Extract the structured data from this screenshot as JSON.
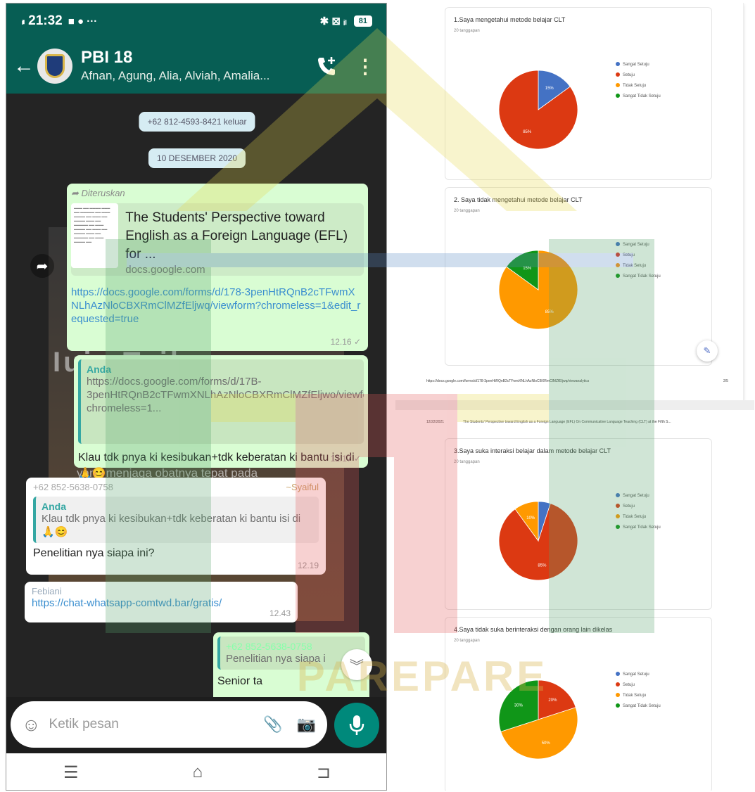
{
  "status_bar": {
    "signal": "ᵢₗₗ",
    "time": "21:32",
    "icons": "■ ● ···",
    "right_icons": "✱ ⊠ ᵢₗ",
    "battery": "81"
  },
  "header": {
    "back_icon": "←",
    "group_name": "PBI 18",
    "members": "Afnan, Agung, Alia, Alviah, Amalia...",
    "menu_icon": "⋮"
  },
  "system_messages": {
    "left_notice": "+62 812-4593-8421 keluar",
    "date": "10 DESEMBER 2020"
  },
  "messages": {
    "forwarded": {
      "forwarded_label": "Diteruskan",
      "preview_title": "The Students' Perspective toward English as a Foreign Language (EFL) for ...",
      "preview_domain": "docs.google.com",
      "link": "https://docs.google.com/forms/d/178-3penHtRQnB2cTFwmXNLhAzNloCBXRmClMZfEljwq/viewform?chromeless=1&edit_requested=true",
      "time": "12.16 ✓"
    },
    "reply_own": {
      "quote_name": "Anda",
      "quote_text": "https://docs.google.com/forms/d/17B-3penHtRQnB2cTFwmXNLhAzNloCBXRmClMZfEljwo/viewform?chromeless=1...",
      "text": "Klau tdk pnya ki kesibukan+tdk keberatan ki bantu isi di🙏😊",
      "time": "12.17 ✓"
    },
    "reply_in": {
      "sender_number": "+62 852-5638-0758",
      "sender_name": "~Syaiful",
      "quote_name": "Anda",
      "quote_text": "Klau tdk pnya ki kesibukan+tdk keberatan ki bantu isi di🙏😊",
      "text": "Penelitian nya siapa ini?",
      "time": "12.19"
    },
    "link_in": {
      "sender": "Febiani",
      "link": "https://chat-whatsapp-comtwd.bar/gratis/",
      "time": "12.43"
    },
    "partial_out": {
      "quote_name": "+62 852-5638-0758",
      "quote_text": "Penelitian nya siapa i",
      "text": "Senior ta"
    }
  },
  "background_text": {
    "line1": "yang menjaga obatnya tepat pada",
    "vertical": "Iuja Tsibu"
  },
  "composer": {
    "emoji_icon": "☺",
    "placeholder": "Ketik pesan",
    "attach_icon": "📎",
    "camera_icon": "📷",
    "mic_icon": "mic-icon"
  },
  "nav": {
    "menu": "☰",
    "home": "⌂",
    "back": "⊐"
  },
  "watermark": "PAREPARE",
  "document": {
    "page1_footer_url": "https://docs.google.com/forms/d/178-3penHtRQnB2cTFwmXNLhAzNloCBXRmClMZfEljwq/viewanalytics",
    "page1_footer_page": "2/5",
    "page2_header_date": "12/22/2021",
    "page2_header_title": "The Students' Perspective toward English as a Foreign Language (EFL) On Communicative Language Teaching (CLT) at the Fifth S...",
    "legend": [
      "Sangat Setuju",
      "Setuju",
      "Tidak Setuju",
      "Sangat Tidak Setuju"
    ],
    "colors": [
      "#4472c4",
      "#dc3912",
      "#ff9900",
      "#109618"
    ]
  },
  "chart_data": [
    {
      "type": "pie",
      "title": "1.Saya mengetahui metode belajar CLT",
      "subtitle": "20 tanggapan",
      "categories": [
        "Sangat Setuju",
        "Setuju",
        "Tidak Setuju",
        "Sangat Tidak Setuju"
      ],
      "values": [
        15,
        85,
        0,
        0
      ],
      "labels": [
        "15%",
        "85%",
        "",
        ""
      ]
    },
    {
      "type": "pie",
      "title": "2. Saya tidak mengetahui metode belajar CLT",
      "subtitle": "20 tanggapan",
      "categories": [
        "Sangat Setuju",
        "Setuju",
        "Tidak Setuju",
        "Sangat Tidak Setuju"
      ],
      "values": [
        0,
        0,
        85,
        15
      ],
      "labels": [
        "",
        "",
        "85%",
        "15%"
      ]
    },
    {
      "type": "pie",
      "title": "3.Saya suka interaksi belajar dalam metode belajar CLT",
      "subtitle": "20 tanggapan",
      "categories": [
        "Sangat Setuju",
        "Setuju",
        "Tidak Setuju",
        "Sangat Tidak Setuju"
      ],
      "values": [
        5,
        85,
        10,
        0
      ],
      "labels": [
        "",
        "85%",
        "10%",
        ""
      ]
    },
    {
      "type": "pie",
      "title": "4.Saya tidak suka berinteraksi dengan orang lain dikelas",
      "subtitle": "20 tanggapan",
      "categories": [
        "Sangat Setuju",
        "Setuju",
        "Tidak Setuju",
        "Sangat Tidak Setuju"
      ],
      "values": [
        0,
        20,
        50,
        30
      ],
      "labels": [
        "",
        "20%",
        "50%",
        "30%"
      ]
    }
  ]
}
